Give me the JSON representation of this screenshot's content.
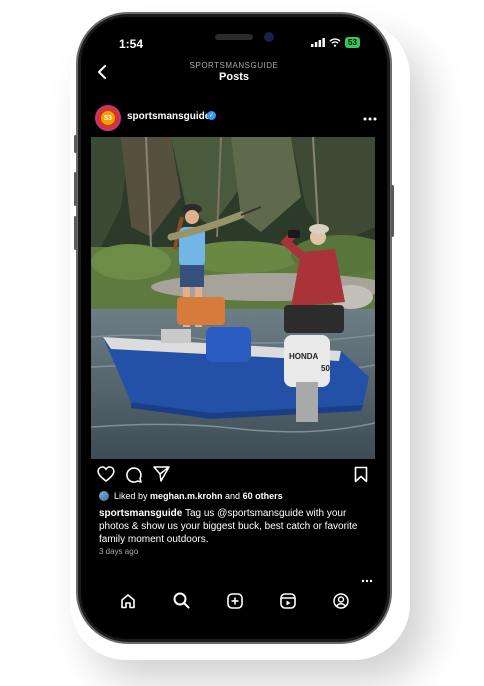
{
  "status_bar": {
    "time": "1:54",
    "battery": "53"
  },
  "header": {
    "account": "SPORTSMANSGUIDE",
    "title": "Posts"
  },
  "post": {
    "avatar_text": "53",
    "username": "sportsmansguide",
    "liked_by_prefix": "Liked by ",
    "liked_by_user": "meghan.m.krohn",
    "liked_by_middle": " and ",
    "liked_by_others": "60 others",
    "caption_user": "sportsmansguide",
    "caption_text": "Tag us @sportsmansguide with your photos & show us your biggest buck, best catch or favorite family moment outdoors.",
    "date": "3 days ago",
    "motor_brand": "HONDA",
    "motor_hp": "50"
  },
  "icons": {
    "back": "chevron-left-icon",
    "more": "more-icon",
    "like": "heart-icon",
    "comment": "comment-icon",
    "share": "send-icon",
    "save": "bookmark-icon",
    "tabs": [
      "home-icon",
      "search-icon",
      "create-icon",
      "reels-icon",
      "profile-icon"
    ]
  },
  "colors": {
    "verified": "#3897f0",
    "battery": "#34c759",
    "background": "#000000"
  }
}
